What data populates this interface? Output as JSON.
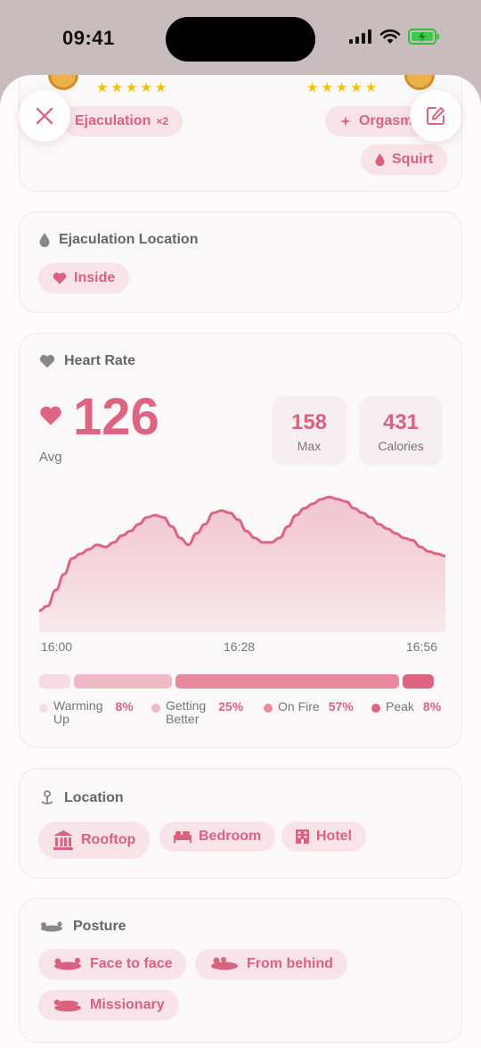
{
  "status": {
    "time": "09:41"
  },
  "top_card": {
    "left_rating": "★★★★★",
    "right_rating": "★★★★★",
    "chips": [
      {
        "label": "Ejaculation",
        "count": "×2"
      },
      {
        "label": "Orgasm"
      },
      {
        "label": "Squirt"
      }
    ]
  },
  "ejaculation": {
    "title": "Ejaculation Location",
    "chip": "Inside"
  },
  "heart_rate": {
    "title": "Heart Rate",
    "avg": "126",
    "avg_label": "Avg",
    "max": "158",
    "max_label": "Max",
    "calories": "431",
    "calories_label": "Calories",
    "times": [
      "16:00",
      "16:28",
      "16:56"
    ],
    "zones": [
      {
        "label": "Warming Up",
        "line1": "Warming",
        "line2": "Up",
        "pct": "8%",
        "color": "#f6dde3"
      },
      {
        "label": "Getting Better",
        "line1": "Getting",
        "line2": "Better",
        "pct": "25%",
        "color": "#efb9c6"
      },
      {
        "label": "On Fire",
        "pct": "57%",
        "color": "#e8899f"
      },
      {
        "label": "Peak",
        "pct": "8%",
        "color": "#dd6581"
      }
    ]
  },
  "chart_data": {
    "type": "area",
    "x": [
      "16:00",
      "16:28",
      "16:56"
    ],
    "series": [
      {
        "values": [
          96,
          98,
          105,
          112,
          119,
          121,
          123,
          125,
          124,
          126,
          129,
          131,
          134,
          137,
          138,
          137,
          133,
          128,
          125,
          130,
          134,
          139,
          140,
          139,
          136,
          131,
          128,
          126,
          126,
          128,
          133,
          138,
          141,
          143,
          145,
          146,
          145,
          144,
          141,
          139,
          137,
          134,
          132,
          130,
          128,
          127,
          124,
          122,
          121,
          120
        ]
      }
    ],
    "color": "#dd6581"
  },
  "location": {
    "title": "Location",
    "chips": [
      "Rooftop",
      "Bedroom",
      "Hotel"
    ]
  },
  "posture": {
    "title": "Posture",
    "chips": [
      "Face to face",
      "From behind",
      "Missionary"
    ]
  },
  "colors": {
    "accent": "#dd6581",
    "chip_bg": "#f7e3e8"
  }
}
